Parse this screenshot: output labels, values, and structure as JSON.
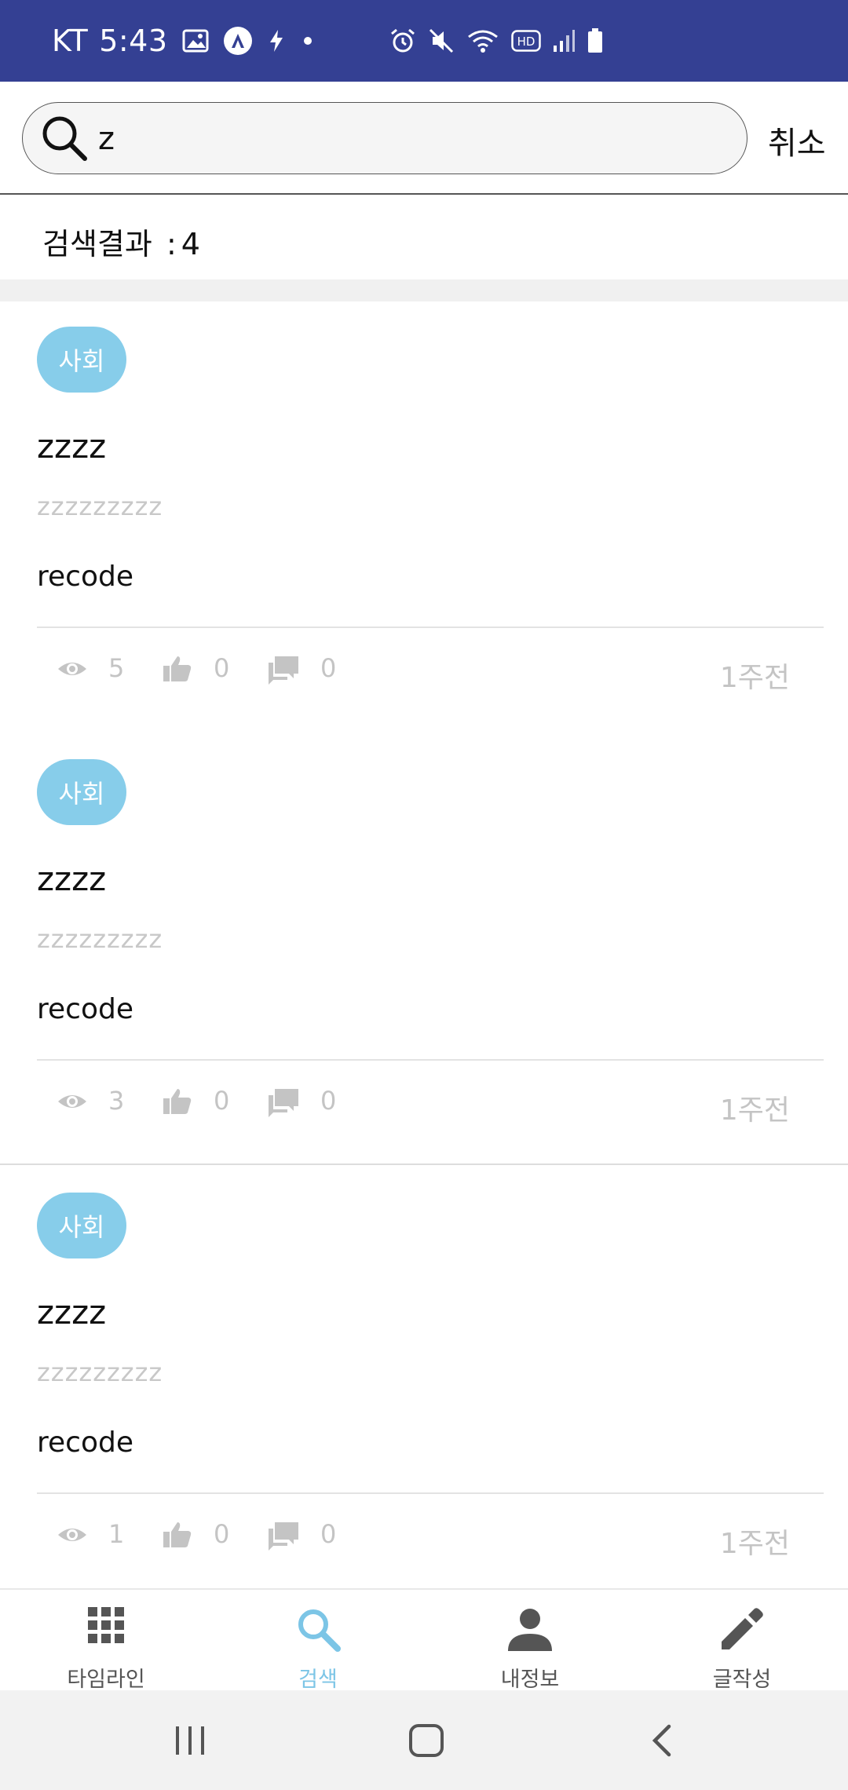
{
  "status_bar": {
    "carrier": "KT",
    "time": "5:43",
    "left_icons": [
      "image-icon",
      "a-circle-icon",
      "bolt-icon",
      "dot-icon"
    ],
    "right_icons": [
      "alarm-icon",
      "mute-icon",
      "wifi-icon",
      "hd-icon",
      "signal-icon",
      "battery-icon"
    ],
    "background_color": "#344093"
  },
  "search": {
    "query": "z",
    "cancel_label": "취소"
  },
  "results": {
    "label": "검색결과",
    "separator": ":",
    "count": "4"
  },
  "posts": [
    {
      "tag": "사회",
      "title": "zzzz",
      "preview": "zzzzzzzzz",
      "author": "recode",
      "views": "5",
      "likes": "0",
      "comments": "0",
      "time": "1주전"
    },
    {
      "tag": "사회",
      "title": "zzzz",
      "preview": "zzzzzzzzz",
      "author": "recode",
      "views": "3",
      "likes": "0",
      "comments": "0",
      "time": "1주전"
    },
    {
      "tag": "사회",
      "title": "zzzz",
      "preview": "zzzzzzzzz",
      "author": "recode",
      "views": "1",
      "likes": "0",
      "comments": "0",
      "time": "1주전"
    }
  ],
  "bottom_nav": {
    "items": [
      {
        "label": "타임라인",
        "icon": "grid-icon"
      },
      {
        "label": "검색",
        "icon": "search-icon",
        "active": true
      },
      {
        "label": "내정보",
        "icon": "person-icon"
      },
      {
        "label": "글작성",
        "icon": "pencil-icon"
      }
    ],
    "active_color": "#7cc5e6"
  },
  "system_nav": {
    "buttons": [
      "recent-apps-icon",
      "home-icon",
      "back-icon"
    ]
  },
  "colors": {
    "tag_background": "#87cdea",
    "muted_text": "#c4c4c4"
  }
}
